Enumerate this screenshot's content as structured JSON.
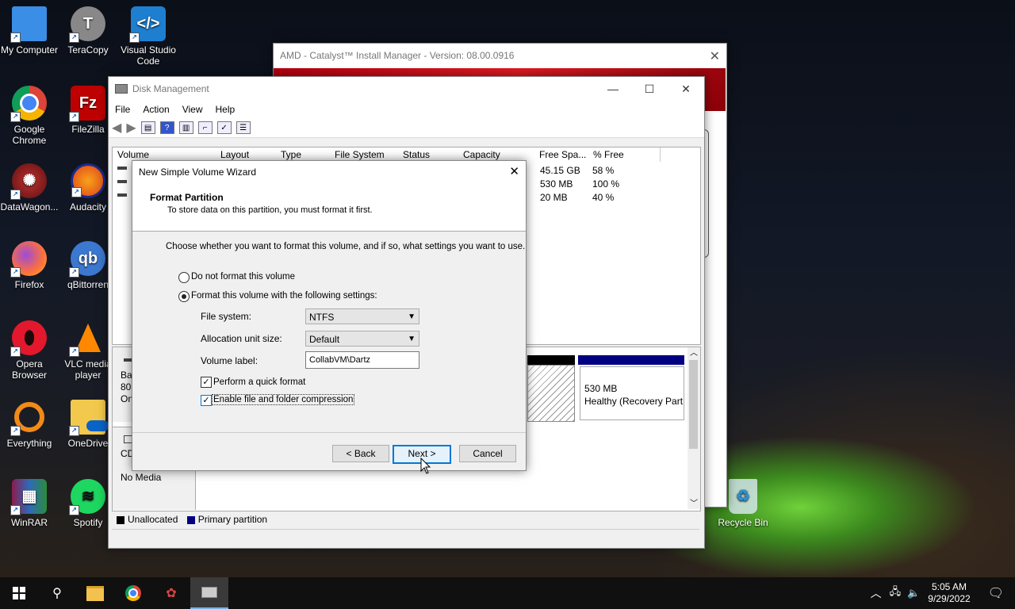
{
  "desktop_icons": [
    {
      "label": "My Computer",
      "icon": "computer-icon"
    },
    {
      "label": "TeraCopy",
      "icon": "teracopy-icon"
    },
    {
      "label": "Visual Studio Code",
      "icon": "vscode-icon"
    },
    {
      "label": "Google Chrome",
      "icon": "chrome-icon"
    },
    {
      "label": "FileZilla",
      "icon": "filezilla-icon"
    },
    {
      "label": "DataWagon...",
      "icon": "datawagon-icon"
    },
    {
      "label": "Audacity",
      "icon": "audacity-icon"
    },
    {
      "label": "Firefox",
      "icon": "firefox-icon"
    },
    {
      "label": "qBittorren",
      "icon": "qbittorrent-icon"
    },
    {
      "label": "Opera Browser",
      "icon": "opera-icon"
    },
    {
      "label": "VLC media player",
      "icon": "vlc-icon"
    },
    {
      "label": "Everything",
      "icon": "everything-icon"
    },
    {
      "label": "OneDrive",
      "icon": "onedrive-icon"
    },
    {
      "label": "WinRAR",
      "icon": "winrar-icon"
    },
    {
      "label": "Spotify",
      "icon": "spotify-icon"
    },
    {
      "label": "Recycle Bin",
      "icon": "recycle-bin-icon"
    }
  ],
  "amd": {
    "title": "AMD - Catalyst™ Install Manager - Version: 08.00.0916"
  },
  "disk": {
    "title": "Disk Management",
    "menu": [
      "File",
      "Action",
      "View",
      "Help"
    ],
    "columns": [
      "Volume",
      "Layout",
      "Type",
      "File System",
      "Status",
      "Capacity",
      "Free Spa...",
      "% Free"
    ],
    "rows": [
      {
        "free": "45.15 GB",
        "pct": "58 %"
      },
      {
        "free": "530 MB",
        "pct": "100 %"
      },
      {
        "free": "20 MB",
        "pct": "40 %"
      }
    ],
    "lower": {
      "disk_label_frag": "Ba",
      "disk_size_frag": "80.",
      "disk_status_frag": "On",
      "cd_frag": "CD",
      "no_media": "No Media",
      "partition_size": "530 MB",
      "partition_status": "Healthy (Recovery Part"
    },
    "legend": {
      "unallocated": "Unallocated",
      "primary": "Primary partition"
    }
  },
  "wizard": {
    "title": "New Simple Volume Wizard",
    "heading": "Format Partition",
    "subheading": "To store data on this partition, you must format it first.",
    "instruction": "Choose whether you want to format this volume, and if so, what settings you want to use.",
    "opt_no": "Do not format this volume",
    "opt_yes": "Format this volume with the following settings:",
    "fs_label": "File system:",
    "fs_value": "NTFS",
    "alloc_label": "Allocation unit size:",
    "alloc_value": "Default",
    "vol_label": "Volume label:",
    "vol_value": "CollabVM\\Dartz",
    "quick_format": "Perform a quick format",
    "compression": "Enable file and folder compression",
    "back": "< Back",
    "next": "Next >",
    "cancel": "Cancel"
  },
  "clock": {
    "time": "5:05 AM",
    "date": "9/29/2022"
  }
}
